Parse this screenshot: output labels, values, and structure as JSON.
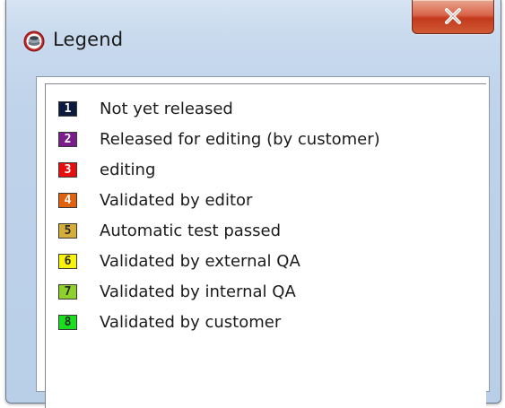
{
  "window": {
    "title": "Legend",
    "icon": "legend-app-icon",
    "close_label": "x"
  },
  "legend": {
    "items": [
      {
        "number": "1",
        "label": "Not yet released",
        "color": "#0b1a3d",
        "text_color": "#ffffff"
      },
      {
        "number": "2",
        "label": "Released for editing (by customer)",
        "color": "#7b1b8c",
        "text_color": "#ffffff"
      },
      {
        "number": "3",
        "label": "editing",
        "color": "#e60f0f",
        "text_color": "#ffffff"
      },
      {
        "number": "4",
        "label": "Validated by editor",
        "color": "#e0620f",
        "text_color": "#ffffff"
      },
      {
        "number": "5",
        "label": "Automatic test passed",
        "color": "#d4ad3a",
        "text_color": "#2a2a2a"
      },
      {
        "number": "6",
        "label": "Validated by external QA",
        "color": "#f7f40a",
        "text_color": "#2a2a2a"
      },
      {
        "number": "7",
        "label": "Validated by internal QA",
        "color": "#8ed12a",
        "text_color": "#2a2a2a"
      },
      {
        "number": "8",
        "label": "Validated by customer",
        "color": "#18e01e",
        "text_color": "#2a2a2a"
      }
    ]
  }
}
